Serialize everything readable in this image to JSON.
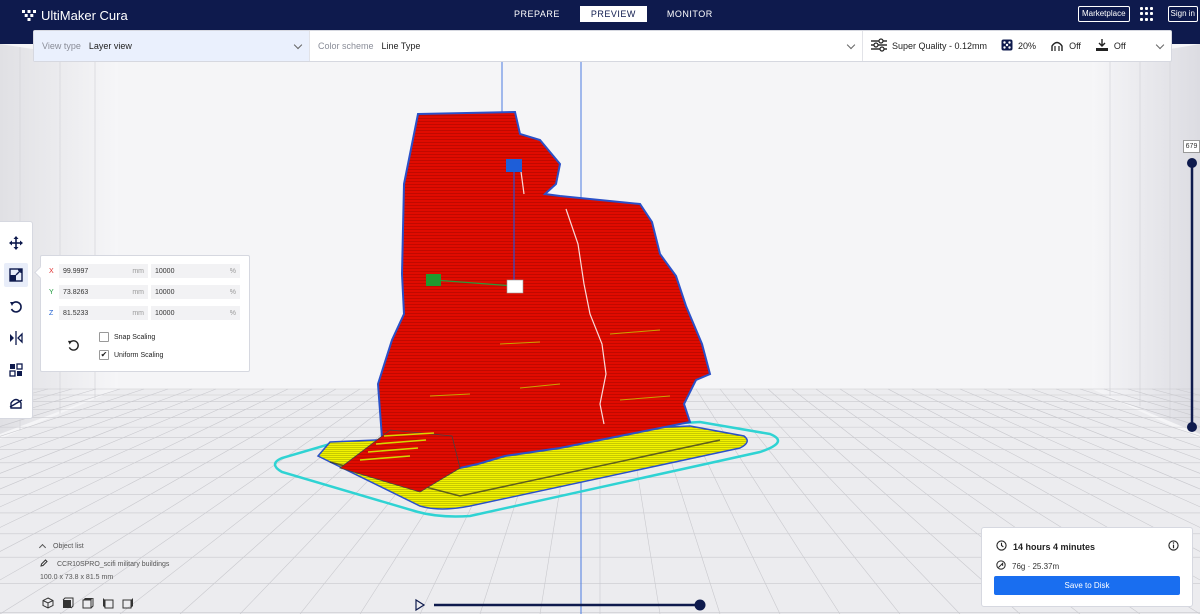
{
  "app": {
    "title": "UltiMaker Cura"
  },
  "stages": [
    {
      "label": "PREPARE",
      "active": false
    },
    {
      "label": "PREVIEW",
      "active": true
    },
    {
      "label": "MONITOR",
      "active": false
    }
  ],
  "header_right": {
    "marketplace_label": "Marketplace",
    "signin_label": "Sign in"
  },
  "topbar": {
    "view_type_label": "View type",
    "view_type_value": "Layer view",
    "color_scheme_label": "Color scheme",
    "color_scheme_value": "Line Type",
    "profile": "Super Quality - 0.12mm",
    "infill": "20%",
    "support": "Off",
    "adhesion": "Off"
  },
  "scale_panel": {
    "x": {
      "axis": "X",
      "mm": "99.9997",
      "pct": "10000",
      "color": "#e03030"
    },
    "y": {
      "axis": "Y",
      "mm": "73.8263",
      "pct": "10000",
      "color": "#1a9a3a"
    },
    "z": {
      "axis": "Z",
      "mm": "81.5233",
      "pct": "10000",
      "color": "#2060d0"
    },
    "mm_unit": "mm",
    "pct_unit": "%",
    "snap_scaling": "Snap Scaling",
    "snap_checked": false,
    "uniform_scaling": "Uniform Scaling",
    "uniform_checked": true
  },
  "object_list": {
    "header": "Object list",
    "object_name": "CCR10SPRO_scifi military buildings",
    "dimensions": "100.0 x 73.8 x 81.5 mm"
  },
  "layer_slider": {
    "current_layer": "679"
  },
  "print_info": {
    "time": "14 hours 4 minutes",
    "material": "76g · 25.37m",
    "save_label": "Save to Disk"
  },
  "colors": {
    "header_bg": "#0e1a4d",
    "accent": "#196ef0",
    "model_wall": "#e00b00",
    "skin": "#f0f000",
    "skirt": "#30d0d0"
  }
}
